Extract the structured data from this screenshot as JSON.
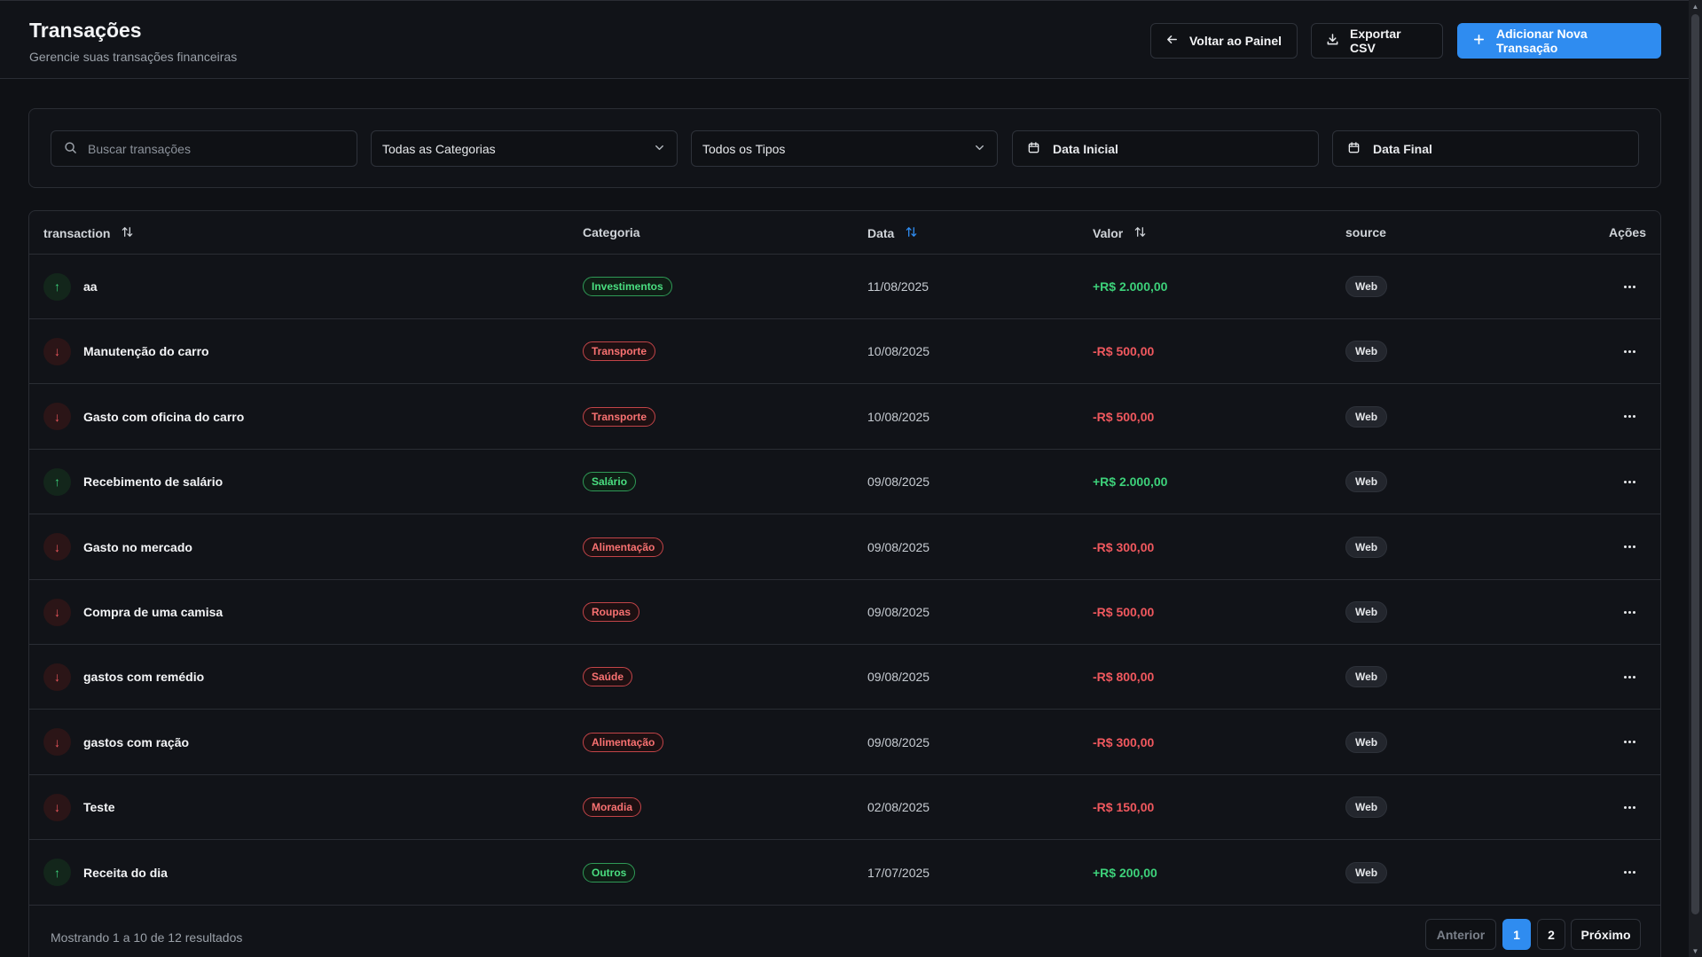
{
  "header": {
    "title": "Transações",
    "subtitle": "Gerencie suas transações financeiras",
    "back_label": "Voltar ao Painel",
    "export_label": "Exportar CSV",
    "add_label": "Adicionar Nova Transação"
  },
  "filters": {
    "search_placeholder": "Buscar transações",
    "category_value": "Todas as Categorias",
    "type_value": "Todos os Tipos",
    "start_date_label": "Data Inicial",
    "end_date_label": "Data Final"
  },
  "table": {
    "columns": [
      "transaction",
      "Categoria",
      "Data",
      "Valor",
      "source",
      "Ações"
    ],
    "rows": [
      {
        "kind": "in",
        "arrow": "↑",
        "description": "aa",
        "category": "Investimentos",
        "date": "11/08/2025",
        "amount": "+R$ 2.000,00",
        "source": "Web"
      },
      {
        "kind": "out",
        "arrow": "↓",
        "description": "Manutenção do carro",
        "category": "Transporte",
        "date": "10/08/2025",
        "amount": "-R$ 500,00",
        "source": "Web"
      },
      {
        "kind": "out",
        "arrow": "↓",
        "description": "Gasto com oficina do carro",
        "category": "Transporte",
        "date": "10/08/2025",
        "amount": "-R$ 500,00",
        "source": "Web"
      },
      {
        "kind": "in",
        "arrow": "↑",
        "description": "Recebimento de salário",
        "category": "Salário",
        "date": "09/08/2025",
        "amount": "+R$ 2.000,00",
        "source": "Web"
      },
      {
        "kind": "out",
        "arrow": "↓",
        "description": "Gasto no mercado",
        "category": "Alimentação",
        "date": "09/08/2025",
        "amount": "-R$ 300,00",
        "source": "Web"
      },
      {
        "kind": "out",
        "arrow": "↓",
        "description": "Compra de uma camisa",
        "category": "Roupas",
        "date": "09/08/2025",
        "amount": "-R$ 500,00",
        "source": "Web"
      },
      {
        "kind": "out",
        "arrow": "↓",
        "description": "gastos com remédio",
        "category": "Saúde",
        "date": "09/08/2025",
        "amount": "-R$ 800,00",
        "source": "Web"
      },
      {
        "kind": "out",
        "arrow": "↓",
        "description": "gastos com ração",
        "category": "Alimentação",
        "date": "09/08/2025",
        "amount": "-R$ 300,00",
        "source": "Web"
      },
      {
        "kind": "out",
        "arrow": "↓",
        "description": "Teste",
        "category": "Moradia",
        "date": "02/08/2025",
        "amount": "-R$ 150,00",
        "source": "Web"
      },
      {
        "kind": "in",
        "arrow": "↑",
        "description": "Receita do dia",
        "category": "Outros",
        "date": "17/07/2025",
        "amount": "+R$ 200,00",
        "source": "Web"
      }
    ]
  },
  "pagination": {
    "summary": "Mostrando 1 a 10 de 12 resultados",
    "prev_label": "Anterior",
    "pages": [
      "1",
      "2"
    ],
    "next_label": "Próximo"
  },
  "colors": {
    "accent": "#2f8cf0",
    "income": "#3dd17a",
    "expense": "#f0585e",
    "background": "#0f1115"
  },
  "icons": {
    "back": "arrow-left-icon",
    "export": "download-icon",
    "add": "plus-icon",
    "search": "search-icon",
    "dropdown": "chevron-down-icon",
    "date": "calendar-icon",
    "sort": "sort-icon",
    "row_actions": "more-horizontal-icon"
  }
}
